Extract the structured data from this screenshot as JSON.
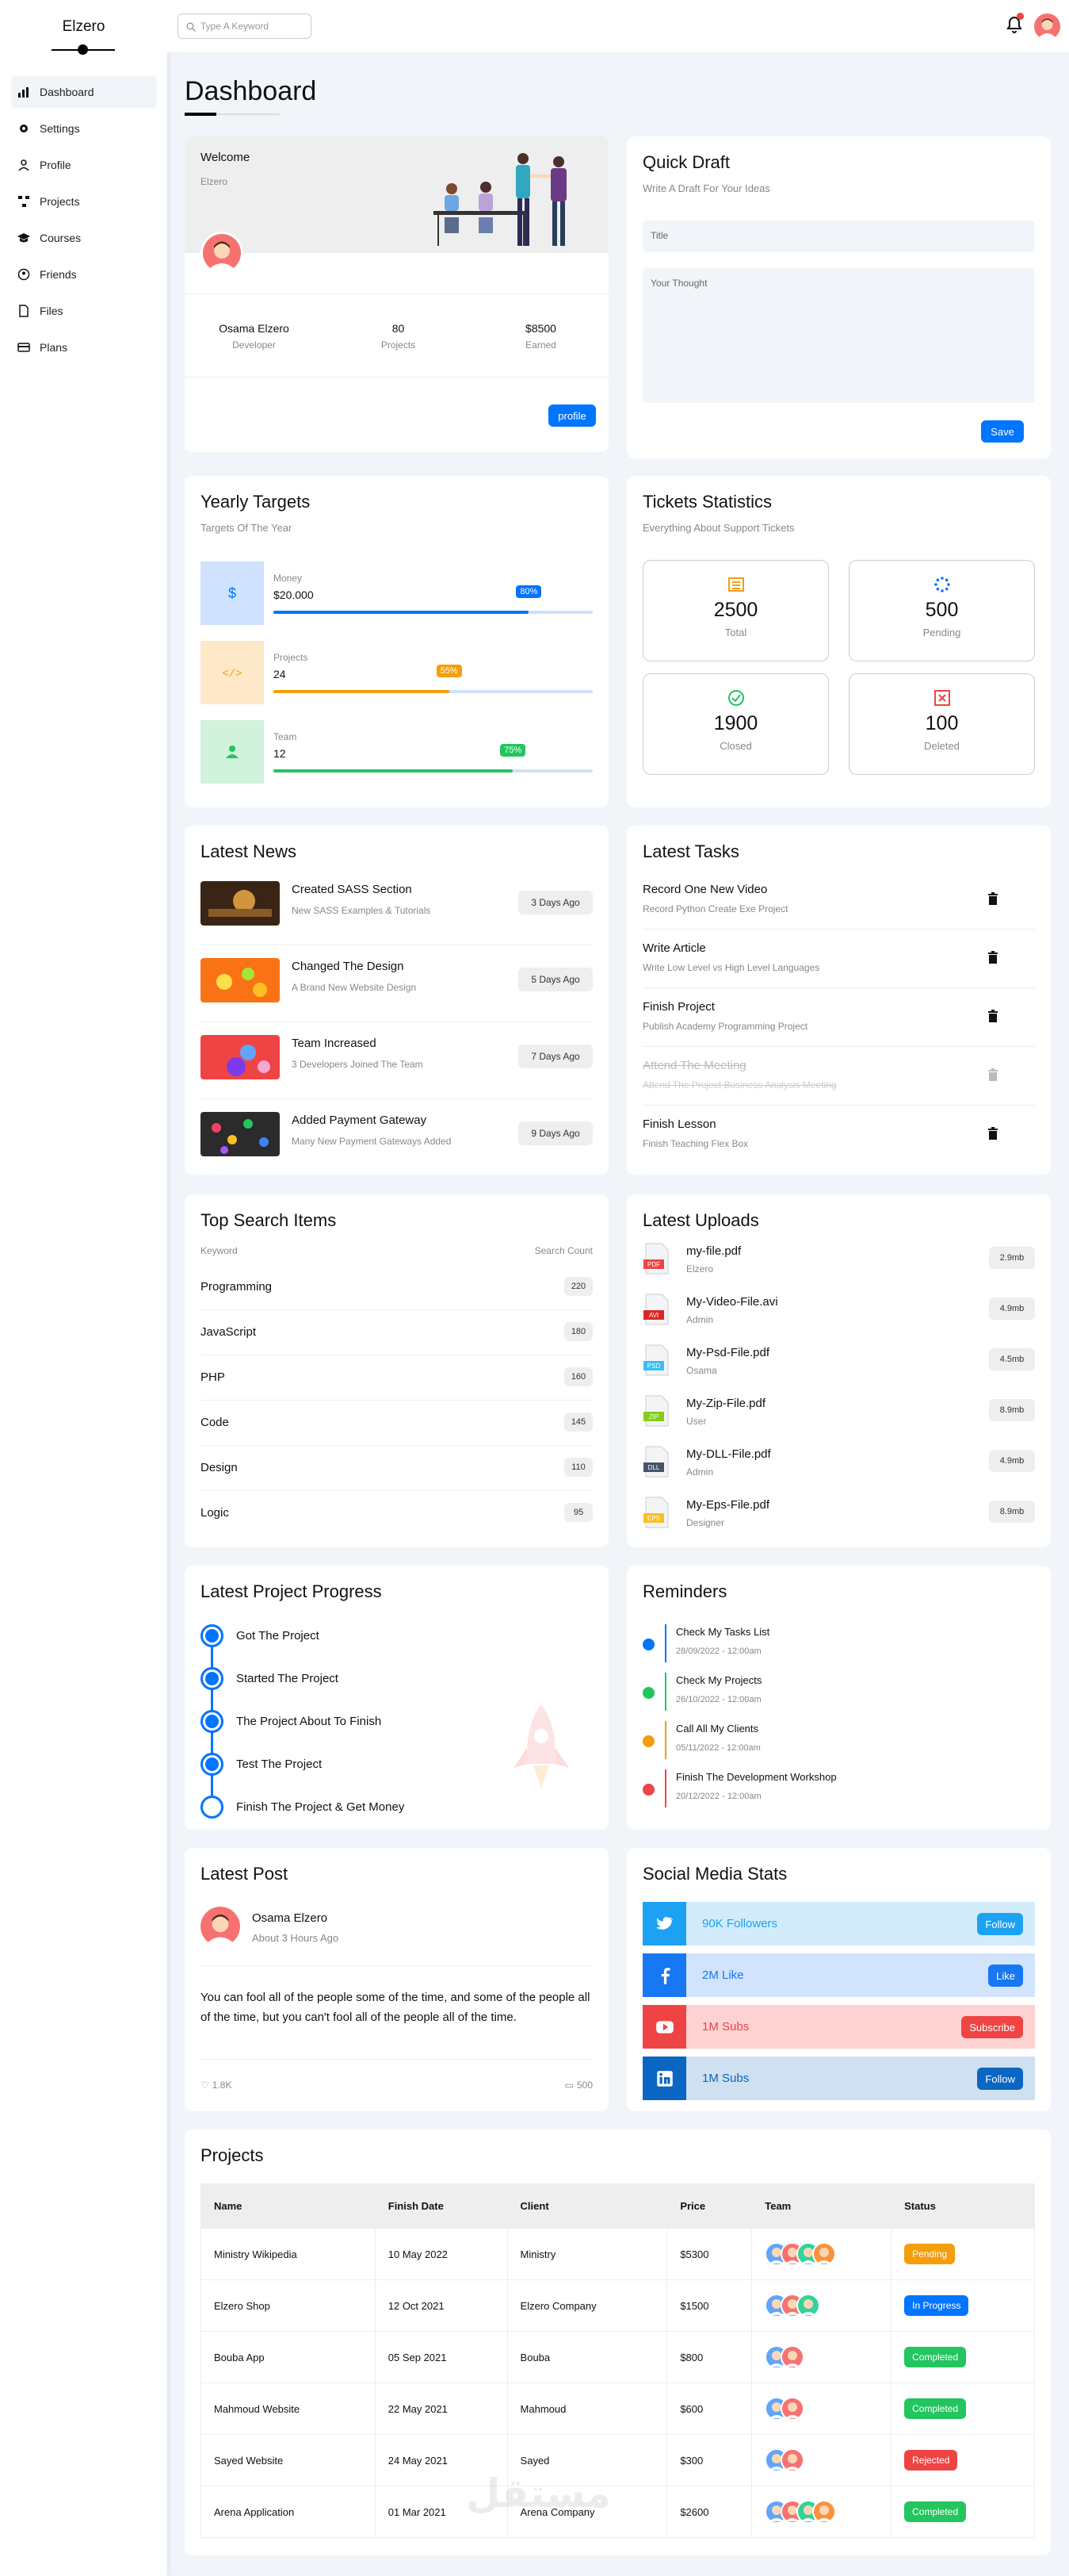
{
  "sidebar": {
    "brand": "Elzero",
    "items": [
      {
        "label": "Dashboard",
        "icon": "chart-icon",
        "active": true
      },
      {
        "label": "Settings",
        "icon": "gear-icon"
      },
      {
        "label": "Profile",
        "icon": "user-icon"
      },
      {
        "label": "Projects",
        "icon": "diagram-icon"
      },
      {
        "label": "Courses",
        "icon": "graduation-cap-icon"
      },
      {
        "label": "Friends",
        "icon": "circle-user-icon"
      },
      {
        "label": "Files",
        "icon": "file-icon"
      },
      {
        "label": "Plans",
        "icon": "credit-card-icon"
      }
    ]
  },
  "topbar": {
    "search_placeholder": "Type A Keyword"
  },
  "page": {
    "title": "Dashboard"
  },
  "welcome": {
    "title": "Welcome",
    "subtitle": "Elzero",
    "name": "Osama Elzero",
    "role": "Developer",
    "projects_value": "80",
    "projects_label": "Projects",
    "earned_value": "$8500",
    "earned_label": "Earned",
    "button": "profile"
  },
  "draft": {
    "title": "Quick Draft",
    "subtitle": "Write A Draft For Your Ideas",
    "title_placeholder": "Title",
    "body_placeholder": "Your Thought",
    "button": "Save"
  },
  "targets": {
    "title": "Yearly Targets",
    "subtitle": "Targets Of The Year",
    "items": [
      {
        "label": "Money",
        "value": "$20.000",
        "progress": 80,
        "progress_label": "80%",
        "color": "#0075ff",
        "bg": "#cfe2ff"
      },
      {
        "label": "Projects",
        "value": "24",
        "progress": 55,
        "progress_label": "55%",
        "color": "#f59e0b",
        "bg": "#fde8c8"
      },
      {
        "label": "Team",
        "value": "12",
        "progress": 75,
        "progress_label": "75%",
        "color": "#22c55e",
        "bg": "#d1f2dc"
      }
    ]
  },
  "tickets": {
    "title": "Tickets Statistics",
    "subtitle": "Everything About Support Tickets",
    "items": [
      {
        "value": "2500",
        "label": "Total",
        "icon": "list-icon",
        "color": "#f59e0b"
      },
      {
        "value": "500",
        "label": "Pending",
        "icon": "spinner-icon",
        "color": "#0075ff"
      },
      {
        "value": "1900",
        "label": "Closed",
        "icon": "check-circle-icon",
        "color": "#22c55e"
      },
      {
        "value": "100",
        "label": "Deleted",
        "icon": "x-square-icon",
        "color": "#ef4444"
      }
    ]
  },
  "news": {
    "title": "Latest News",
    "items": [
      {
        "title": "Created SASS Section",
        "desc": "New SASS Examples & Tutorials",
        "age": "3 Days Ago"
      },
      {
        "title": "Changed The Design",
        "desc": "A Brand New Website Design",
        "age": "5 Days Ago"
      },
      {
        "title": "Team Increased",
        "desc": "3 Developers Joined The Team",
        "age": "7 Days Ago"
      },
      {
        "title": "Added Payment Gateway",
        "desc": "Many New Payment Gateways Added",
        "age": "9 Days Ago"
      }
    ]
  },
  "tasks": {
    "title": "Latest Tasks",
    "items": [
      {
        "title": "Record One New Video",
        "desc": "Record Python Create Exe Project",
        "done": false
      },
      {
        "title": "Write Article",
        "desc": "Write Low Level vs High Level Languages",
        "done": false
      },
      {
        "title": "Finish Project",
        "desc": "Publish Academy Programming Project",
        "done": false
      },
      {
        "title": "Attend The Meeting",
        "desc": "Attend The Project Business Analysis Meeting",
        "done": true
      },
      {
        "title": "Finish Lesson",
        "desc": "Finish Teaching Flex Box",
        "done": false
      }
    ]
  },
  "search": {
    "title": "Top Search Items",
    "col_keyword": "Keyword",
    "col_count": "Search Count",
    "items": [
      {
        "keyword": "Programming",
        "count": "220"
      },
      {
        "keyword": "JavaScript",
        "count": "180"
      },
      {
        "keyword": "PHP",
        "count": "160"
      },
      {
        "keyword": "Code",
        "count": "145"
      },
      {
        "keyword": "Design",
        "count": "110"
      },
      {
        "keyword": "Logic",
        "count": "95"
      }
    ]
  },
  "uploads": {
    "title": "Latest Uploads",
    "items": [
      {
        "name": "my-file.pdf",
        "user": "Elzero",
        "size": "2.9mb",
        "ext": "PDF",
        "color": "#ef4444"
      },
      {
        "name": "My-Video-File.avi",
        "user": "Admin",
        "size": "4.9mb",
        "ext": "AVI",
        "color": "#dc2626"
      },
      {
        "name": "My-Psd-File.pdf",
        "user": "Osama",
        "size": "4.5mb",
        "ext": "PSD",
        "color": "#38bdf8"
      },
      {
        "name": "My-Zip-File.pdf",
        "user": "User",
        "size": "8.9mb",
        "ext": "ZIP",
        "color": "#84cc16"
      },
      {
        "name": "My-DLL-File.pdf",
        "user": "Admin",
        "size": "4.9mb",
        "ext": "DLL",
        "color": "#475569"
      },
      {
        "name": "My-Eps-File.pdf",
        "user": "Designer",
        "size": "8.9mb",
        "ext": "EPS",
        "color": "#fbbf24"
      }
    ]
  },
  "progress": {
    "title": "Latest Project Progress",
    "steps": [
      {
        "label": "Got The Project",
        "done": true
      },
      {
        "label": "Started The Project",
        "done": true
      },
      {
        "label": "The Project About To Finish",
        "done": true
      },
      {
        "label": "Test The Project",
        "done": true
      },
      {
        "label": "Finish The Project & Get Money",
        "done": false
      }
    ]
  },
  "reminders": {
    "title": "Reminders",
    "items": [
      {
        "title": "Check My Tasks List",
        "date": "28/09/2022 - 12:00am",
        "color": "#0075ff"
      },
      {
        "title": "Check My Projects",
        "date": "26/10/2022 - 12:00am",
        "color": "#22c55e"
      },
      {
        "title": "Call All My Clients",
        "date": "05/11/2022 - 12:00am",
        "color": "#f59e0b"
      },
      {
        "title": "Finish The Development Workshop",
        "date": "20/12/2022 - 12:00am",
        "color": "#ef4444"
      }
    ]
  },
  "post": {
    "title": "Latest Post",
    "author": "Osama Elzero",
    "time": "About 3 Hours Ago",
    "text": "You can fool all of the people some of the time, and some of the people all of the time, but you can't fool all of the people all of the time.",
    "likes": "1.8K",
    "comments": "500"
  },
  "social": {
    "title": "Social Media Stats",
    "items": [
      {
        "network": "twitter",
        "text": "90K Followers",
        "button": "Follow",
        "icon": "twitter-icon",
        "color": "#1da1f2",
        "bg": "#d3ecfc"
      },
      {
        "network": "facebook",
        "text": "2M Like",
        "button": "Like",
        "icon": "facebook-icon",
        "color": "#1877f2",
        "bg": "#d1e4fc"
      },
      {
        "network": "youtube",
        "text": "1M Subs",
        "button": "Subscribe",
        "icon": "youtube-icon",
        "color": "#ef4444",
        "bg": "#fcd2d2"
      },
      {
        "network": "linkedin",
        "text": "1M Subs",
        "button": "Follow",
        "icon": "linkedin-icon",
        "color": "#0a66c2",
        "bg": "#cfe0f0"
      }
    ]
  },
  "projects": {
    "title": "Projects",
    "headers": [
      "Name",
      "Finish Date",
      "Client",
      "Price",
      "Team",
      "Status"
    ],
    "rows": [
      {
        "name": "Ministry Wikipedia",
        "date": "10 May 2022",
        "client": "Ministry",
        "price": "$5300",
        "team": 4,
        "status": "Pending",
        "status_color": "#f59e0b"
      },
      {
        "name": "Elzero Shop",
        "date": "12 Oct 2021",
        "client": "Elzero Company",
        "price": "$1500",
        "team": 3,
        "status": "In Progress",
        "status_color": "#0075ff"
      },
      {
        "name": "Bouba App",
        "date": "05 Sep 2021",
        "client": "Bouba",
        "price": "$800",
        "team": 2,
        "status": "Completed",
        "status_color": "#22c55e"
      },
      {
        "name": "Mahmoud Website",
        "date": "22 May 2021",
        "client": "Mahmoud",
        "price": "$600",
        "team": 2,
        "status": "Completed",
        "status_color": "#22c55e"
      },
      {
        "name": "Sayed Website",
        "date": "24 May 2021",
        "client": "Sayed",
        "price": "$300",
        "team": 2,
        "status": "Rejected",
        "status_color": "#ef4444"
      },
      {
        "name": "Arena Application",
        "date": "01 Mar 2021",
        "client": "Arena Company",
        "price": "$2600",
        "team": 4,
        "status": "Completed",
        "status_color": "#22c55e"
      }
    ]
  },
  "watermark": {
    "text": "مستقل"
  }
}
